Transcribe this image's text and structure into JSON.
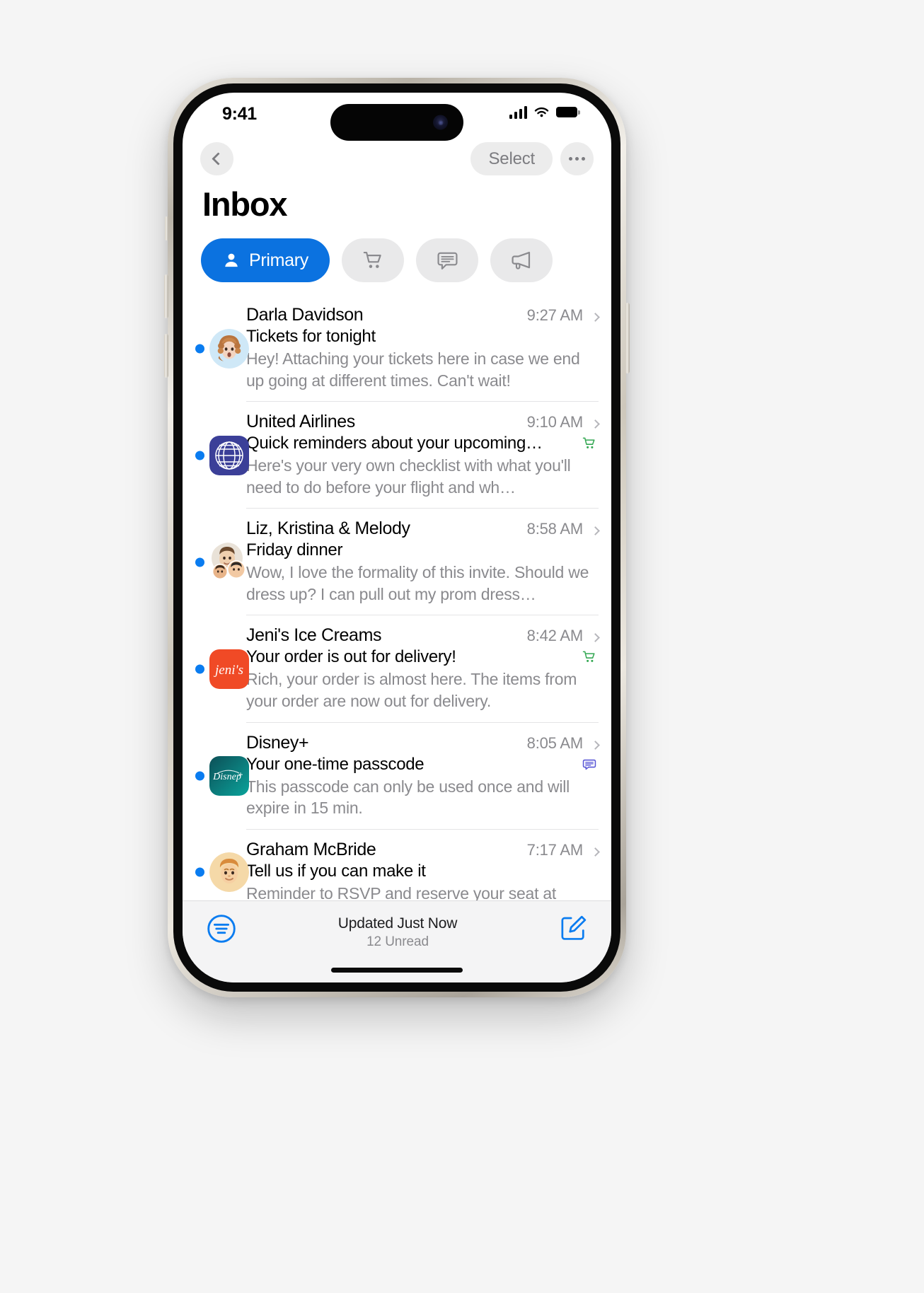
{
  "status_bar": {
    "time": "9:41",
    "cellular_icon": "signal-bars-icon",
    "wifi_icon": "wifi-icon",
    "battery_icon": "battery-icon"
  },
  "nav_bar": {
    "back_icon": "chevron-left-icon",
    "select_label": "Select",
    "more_icon": "ellipsis-icon"
  },
  "page_title": "Inbox",
  "filters": [
    {
      "label": "Primary",
      "icon": "person-icon",
      "active": true,
      "accent": "#0b72e0"
    },
    {
      "label": "Transactions",
      "icon": "shopping-cart-icon",
      "active": false,
      "accent": "#e9e9ea"
    },
    {
      "label": "Updates",
      "icon": "speech-bubble-icon",
      "active": false,
      "accent": "#e9e9ea"
    },
    {
      "label": "Promotions",
      "icon": "megaphone-icon",
      "active": false,
      "accent": "#e9e9ea"
    }
  ],
  "emails": [
    {
      "sender": "Darla Davidson",
      "time": "9:27 AM",
      "subject": "Tickets for tonight",
      "preview": "Hey! Attaching your tickets here in case we end up going at different times. Can't wait!",
      "unread": true,
      "avatar_type": "memoji-woman",
      "category_badge": ""
    },
    {
      "sender": "United Airlines",
      "time": "9:10 AM",
      "subject": "Quick reminders about your upcoming…",
      "preview": "Here's your very own checklist with what you'll need to do before your flight and wh…",
      "unread": true,
      "avatar_type": "united-logo",
      "category_badge": "shopping-cart-icon"
    },
    {
      "sender": "Liz, Kristina & Melody",
      "time": "8:58 AM",
      "subject": "Friday dinner",
      "preview": "Wow, I love the formality of this invite. Should we dress up? I can pull out my prom dress…",
      "unread": true,
      "avatar_type": "memoji-group",
      "category_badge": ""
    },
    {
      "sender": "Jeni's Ice Creams",
      "time": "8:42 AM",
      "subject": "Your order is out for delivery!",
      "preview": "Rich, your order is almost here. The items from your order are now out for delivery.",
      "unread": true,
      "avatar_type": "jenis-logo",
      "category_badge": "shopping-cart-icon"
    },
    {
      "sender": "Disney+",
      "time": "8:05 AM",
      "subject": "Your one-time passcode",
      "preview": "This passcode can only be used once and will expire in 15 min.",
      "unread": true,
      "avatar_type": "disney-logo",
      "category_badge": "speech-bubble-icon"
    },
    {
      "sender": "Graham McBride",
      "time": "7:17 AM",
      "subject": "Tell us if you can make it",
      "preview": "Reminder to RSVP and reserve your seat at",
      "unread": true,
      "avatar_type": "memoji-man",
      "category_badge": ""
    }
  ],
  "toolbar": {
    "filter_icon": "filter-lines-icon",
    "updated_text": "Updated Just Now",
    "unread_count_text": "12 Unread",
    "compose_icon": "compose-square-pencil-icon"
  },
  "colors": {
    "accent_blue": "#0b72e0",
    "unread_dot": "#0a7cf0",
    "badge_green": "#34a853",
    "badge_purple": "#5856d6",
    "separator": "#e4e4e6",
    "secondary_text": "#8a8a8e",
    "pill_inactive_bg": "#e9e9ea"
  }
}
